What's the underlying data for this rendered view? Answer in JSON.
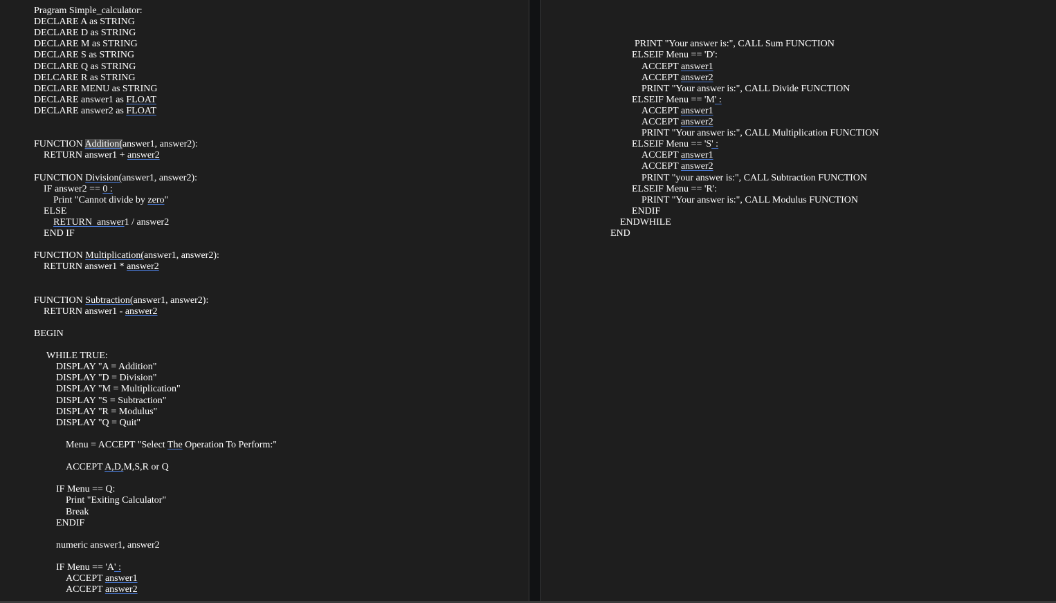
{
  "left_page": {
    "lines": [
      {
        "segments": [
          {
            "text": "Pragram Simple_calculator:"
          }
        ]
      },
      {
        "segments": [
          {
            "text": "DECLARE A as STRING"
          }
        ]
      },
      {
        "segments": [
          {
            "text": "DECLARE D as STRING"
          }
        ]
      },
      {
        "segments": [
          {
            "text": "DECLARE M as STRING"
          }
        ]
      },
      {
        "segments": [
          {
            "text": "DECLARE S as STRING"
          }
        ]
      },
      {
        "segments": [
          {
            "text": "DECLARE Q as STRING"
          }
        ]
      },
      {
        "segments": [
          {
            "text": "DELCARE R as STRING"
          }
        ]
      },
      {
        "segments": [
          {
            "text": "DECLARE MENU as STRING"
          }
        ]
      },
      {
        "segments": [
          {
            "text": "DECLARE answer1 as "
          },
          {
            "text": "FLOAT",
            "underline": true
          }
        ]
      },
      {
        "segments": [
          {
            "text": "DECLARE answer2 as "
          },
          {
            "text": "FLOAT",
            "underline": true
          }
        ]
      },
      {
        "segments": [
          {
            "text": "FUNCTION "
          },
          {
            "text": "Addition(",
            "underline": true,
            "highlight": true
          },
          {
            "text": "answer1, answer2):"
          }
        ]
      },
      {
        "segments": [
          {
            "text": "RETURN answer1 + "
          },
          {
            "text": "answer2",
            "underline": true
          }
        ]
      },
      {
        "segments": [
          {
            "text": "FUNCTION "
          },
          {
            "text": "Division(",
            "underline": true
          },
          {
            "text": "answer1, answer2):"
          }
        ]
      },
      {
        "segments": [
          {
            "text": "IF answer2 == "
          },
          {
            "text": "0 :",
            "underline": true
          }
        ]
      },
      {
        "segments": [
          {
            "text": "Print \"Cannot divide by "
          },
          {
            "text": "zero",
            "underline": true
          },
          {
            "text": "\""
          }
        ]
      },
      {
        "segments": [
          {
            "text": "ELSE"
          }
        ]
      },
      {
        "segments": [
          {
            "text": "RETURN  answer",
            "underline": true
          },
          {
            "text": "1 / answer2"
          }
        ]
      },
      {
        "segments": [
          {
            "text": "END IF"
          }
        ]
      },
      {
        "segments": [
          {
            "text": "FUNCTION "
          },
          {
            "text": "Multiplication(",
            "underline": true
          },
          {
            "text": "answer1, answer2):"
          }
        ]
      },
      {
        "segments": [
          {
            "text": "RETURN answer1 * "
          },
          {
            "text": "answer2",
            "underline": true
          }
        ]
      },
      {
        "segments": [
          {
            "text": "FUNCTION "
          },
          {
            "text": "Subtraction(",
            "underline": true
          },
          {
            "text": "answer1, answer2):"
          }
        ]
      },
      {
        "segments": [
          {
            "text": "RETURN answer1 - "
          },
          {
            "text": "answer2",
            "underline": true
          }
        ]
      },
      {
        "segments": [
          {
            "text": "BEGIN"
          }
        ]
      },
      {
        "segments": [
          {
            "text": "WHILE TRUE:"
          }
        ]
      },
      {
        "segments": [
          {
            "text": "DISPLAY \"A = Addition\""
          }
        ]
      },
      {
        "segments": [
          {
            "text": "DISPLAY \"D = Division\""
          }
        ]
      },
      {
        "segments": [
          {
            "text": "DISPLAY \"M = Multiplication\""
          }
        ]
      },
      {
        "segments": [
          {
            "text": "DISPLAY \"S = Subtraction\""
          }
        ]
      },
      {
        "segments": [
          {
            "text": "DISPLAY \"R = Modulus\""
          }
        ]
      },
      {
        "segments": [
          {
            "text": "DISPLAY \"Q = Quit\""
          }
        ]
      },
      {
        "segments": [
          {
            "text": "Menu = ACCEPT \"Select "
          },
          {
            "text": "The",
            "underline": true
          },
          {
            "text": " Operation To Perform:\""
          }
        ]
      },
      {
        "segments": [
          {
            "text": "ACCEPT "
          },
          {
            "text": "A,D,",
            "underline": true
          },
          {
            "text": "M,S,R or Q"
          }
        ]
      },
      {
        "segments": [
          {
            "text": "IF Menu == Q:"
          }
        ]
      },
      {
        "segments": [
          {
            "text": "Print \"Exiting Calculator\""
          }
        ]
      },
      {
        "segments": [
          {
            "text": "Break"
          }
        ]
      },
      {
        "segments": [
          {
            "text": "ENDIF"
          }
        ]
      },
      {
        "segments": [
          {
            "text": "numeric answer1, answer2"
          }
        ]
      },
      {
        "segments": [
          {
            "text": "IF Menu == 'A"
          },
          {
            "text": "' :",
            "underline": true
          }
        ]
      },
      {
        "segments": [
          {
            "text": "ACCEPT "
          },
          {
            "text": "answer1",
            "underline": true
          }
        ]
      },
      {
        "segments": [
          {
            "text": "ACCEPT "
          },
          {
            "text": "answer2",
            "underline": true
          }
        ]
      }
    ]
  },
  "right_page": {
    "lines": [
      {
        "segments": [
          {
            "text": "PRINT \"Your answer is:\", CALL Sum FUNCTION"
          }
        ]
      },
      {
        "segments": [
          {
            "text": "ELSEIF Menu == 'D':"
          }
        ]
      },
      {
        "segments": [
          {
            "text": "ACCEPT "
          },
          {
            "text": "answer1",
            "underline": true
          }
        ]
      },
      {
        "segments": [
          {
            "text": "ACCEPT "
          },
          {
            "text": "answer2",
            "underline": true
          }
        ]
      },
      {
        "segments": [
          {
            "text": "PRINT \"Your answer is:\", CALL Divide FUNCTION"
          }
        ]
      },
      {
        "segments": [
          {
            "text": "ELSEIF Menu == 'M"
          },
          {
            "text": "' :",
            "underline": true
          }
        ]
      },
      {
        "segments": [
          {
            "text": "ACCEPT "
          },
          {
            "text": "answer1",
            "underline": true
          }
        ]
      },
      {
        "segments": [
          {
            "text": "ACCEPT "
          },
          {
            "text": "answer2",
            "underline": true
          }
        ]
      },
      {
        "segments": [
          {
            "text": "PRINT \"Your answer is:\", CALL Multiplication FUNCTION"
          }
        ]
      },
      {
        "segments": [
          {
            "text": "ELSEIF Menu == 'S"
          },
          {
            "text": "' :",
            "underline": true
          }
        ]
      },
      {
        "segments": [
          {
            "text": "ACCEPT "
          },
          {
            "text": "answer1",
            "underline": true
          }
        ]
      },
      {
        "segments": [
          {
            "text": "ACCEPT "
          },
          {
            "text": "answer2",
            "underline": true
          }
        ]
      },
      {
        "segments": [
          {
            "text": "PRINT \"your answer is:\", CALL Subtraction FUNCTION"
          }
        ]
      },
      {
        "segments": [
          {
            "text": "ELSEIF Menu == 'R':"
          }
        ]
      },
      {
        "segments": [
          {
            "text": "PRINT \"Your answer is:\", CALL Modulus FUNCTION"
          }
        ]
      },
      {
        "segments": [
          {
            "text": "ENDIF"
          }
        ]
      },
      {
        "segments": [
          {
            "text": "ENDWHILE"
          }
        ]
      },
      {
        "segments": [
          {
            "text": "END"
          }
        ]
      }
    ]
  }
}
